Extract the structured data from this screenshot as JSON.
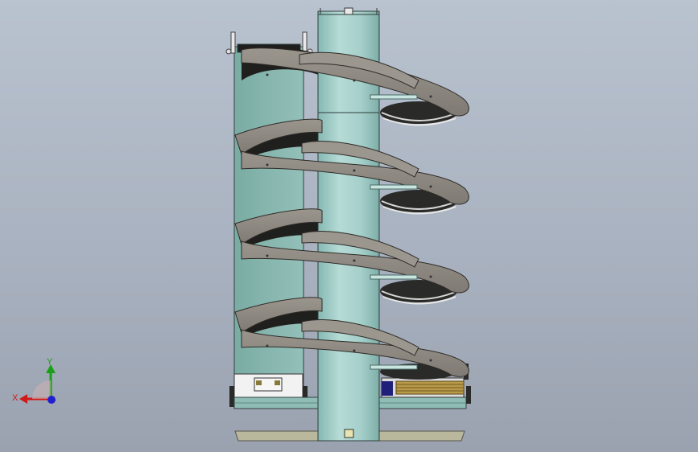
{
  "triad": {
    "x_label": "X",
    "y_label": "Y"
  },
  "colors": {
    "background_top": "#b9c2cf",
    "background_bottom": "#9aa2b0",
    "column": "#a8cfca",
    "helix_band": "#8f8a83",
    "helix_inner": "#1f1f1d",
    "back_panel": "#86b5ad",
    "base_plate": "#b7b69a",
    "axis_x": "#d01818",
    "axis_y": "#1aa018",
    "axis_z": "#2020d0"
  }
}
